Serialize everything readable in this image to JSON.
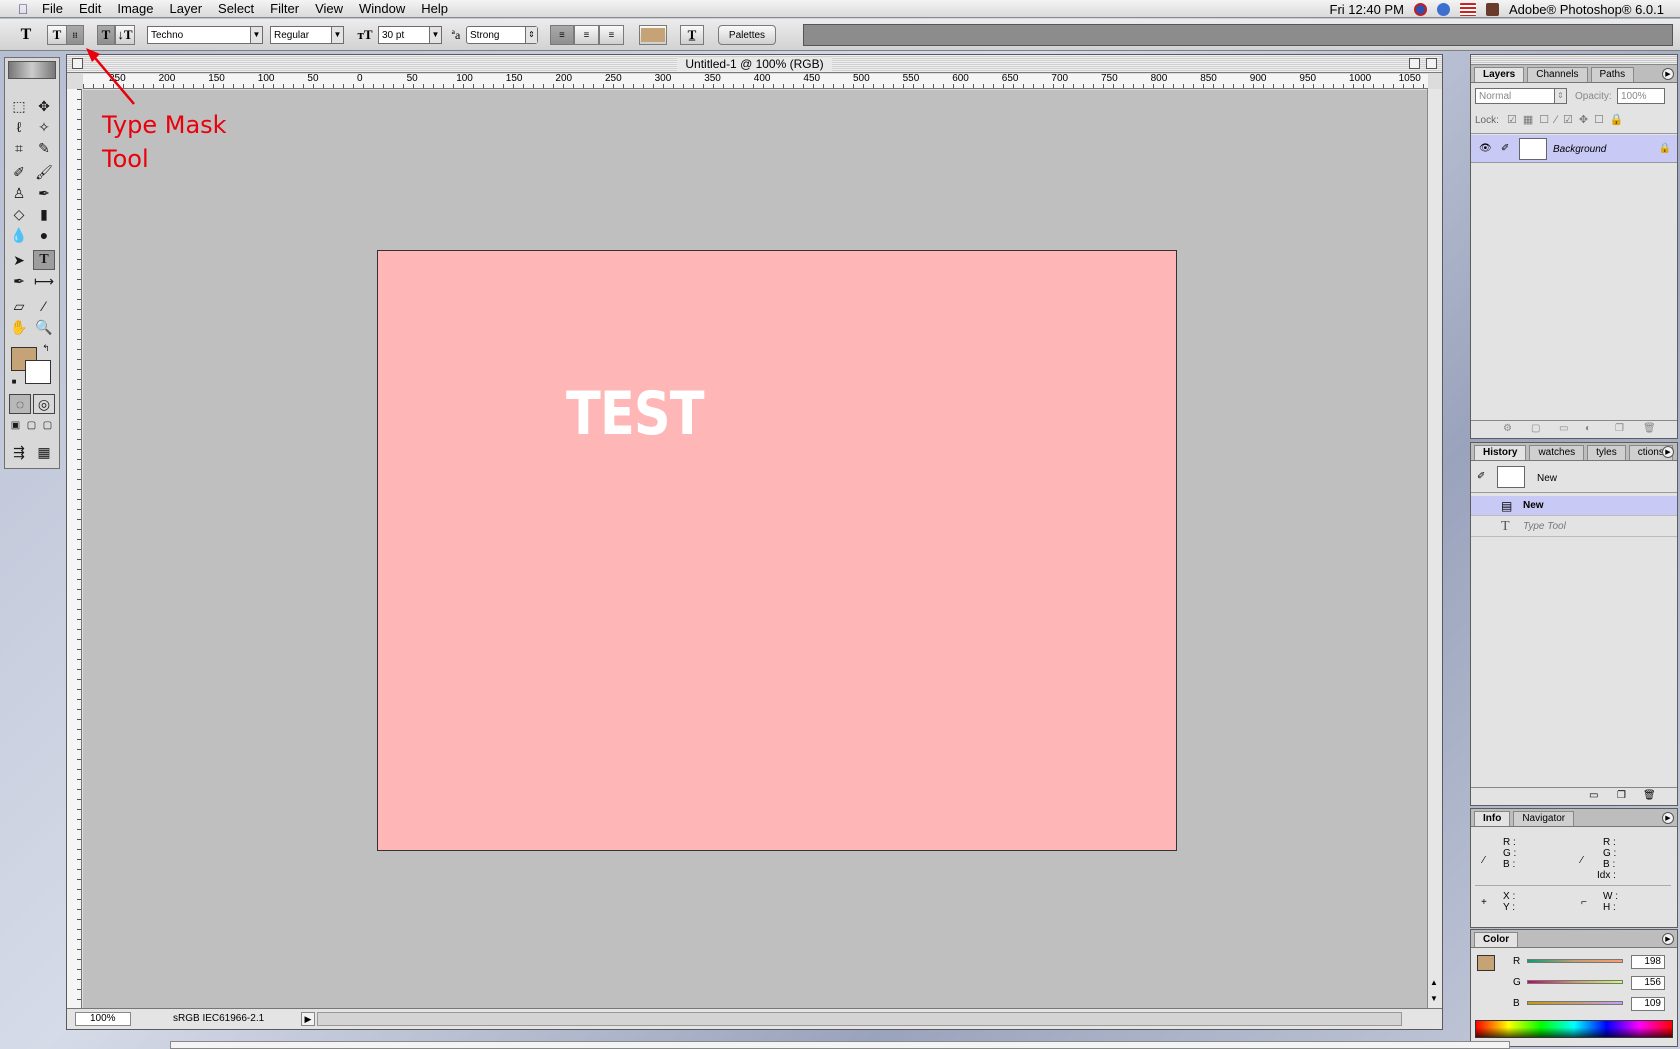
{
  "menubar": {
    "items": [
      "File",
      "Edit",
      "Image",
      "Layer",
      "Select",
      "Filter",
      "View",
      "Window",
      "Help"
    ],
    "clock": "Fri 12:40 PM",
    "app_name": "Adobe® Photoshop® 6.0.1"
  },
  "options": {
    "font_family": "Techno",
    "font_style": "Regular",
    "font_size": "30 pt",
    "aa_label": "ªa",
    "antialias": "Strong",
    "color_swatch": "#c6a377",
    "palettes_label": "Palettes"
  },
  "document": {
    "title": "Untitled-1 @ 100% (RGB)",
    "zoom": "100%",
    "profile": "sRGB IEC61966-2.1",
    "canvas_color": "#ffb6b6",
    "canvas_text": "TEST"
  },
  "ruler": {
    "h_labels": [
      "250",
      "200",
      "150",
      "100",
      "50",
      "0",
      "50",
      "100",
      "150",
      "200",
      "250",
      "300",
      "350",
      "400",
      "450",
      "500",
      "550",
      "600",
      "650",
      "700",
      "750",
      "800",
      "850",
      "900",
      "950",
      "1000",
      "1050"
    ]
  },
  "annotation": {
    "line1": "Type Mask",
    "line2": "Tool",
    "color": "#e8000b"
  },
  "layers": {
    "tabs": [
      "Layers",
      "Channels",
      "Paths"
    ],
    "blend_mode": "Normal",
    "opacity_label": "Opacity:",
    "opacity": "100%",
    "lock_label": "Lock:",
    "layer_name": "Background"
  },
  "history": {
    "tabs": [
      "History",
      "watches",
      "tyles",
      "ctions"
    ],
    "snapshot_label": "New",
    "steps": [
      "New",
      "Type Tool"
    ]
  },
  "info": {
    "tabs": [
      "Info",
      "Navigator"
    ],
    "rgb_labels": [
      "R :",
      "G :",
      "B :"
    ],
    "idx_label": "Idx :",
    "xy_labels": [
      "X :",
      "Y :"
    ],
    "wh_labels": [
      "W :",
      "H :"
    ]
  },
  "color": {
    "tab": "Color",
    "r_label": "R",
    "g_label": "G",
    "b_label": "B",
    "r": "198",
    "g": "156",
    "b": "109",
    "fg": "#c6a377"
  }
}
